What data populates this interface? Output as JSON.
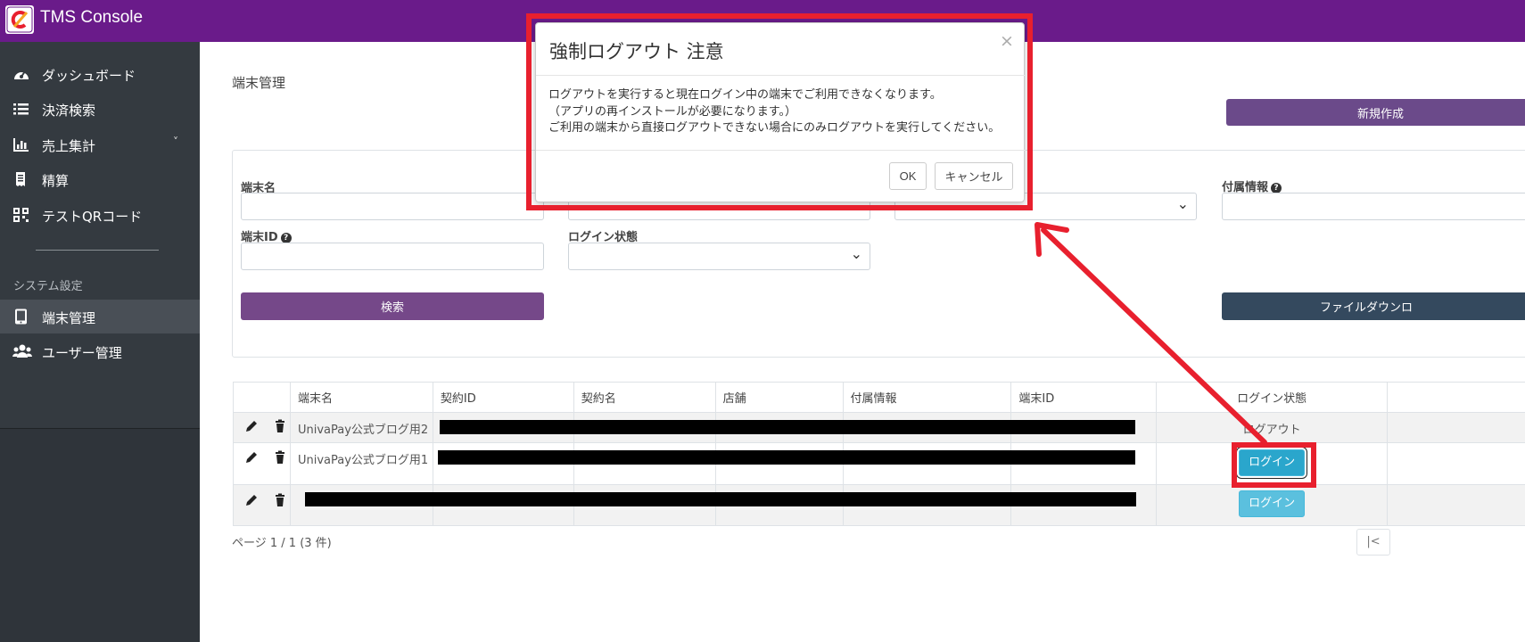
{
  "app": {
    "title": "TMS Console"
  },
  "sidebar": {
    "items": [
      {
        "label": "ダッシュボード",
        "icon": "dashboard-icon"
      },
      {
        "label": "決済検索",
        "icon": "list-icon"
      },
      {
        "label": "売上集計",
        "icon": "bar-chart-icon",
        "chevron": "˅"
      },
      {
        "label": "精算",
        "icon": "receipt-icon"
      },
      {
        "label": "テストQRコード",
        "icon": "qr-code-icon"
      }
    ],
    "section_heading": "システム設定",
    "settings_items": [
      {
        "label": "端末管理",
        "icon": "tablet-icon",
        "active": true
      },
      {
        "label": "ユーザー管理",
        "icon": "users-icon"
      }
    ]
  },
  "main": {
    "page_title": "端末管理",
    "new_button": "新規作成",
    "search": {
      "terminal_name_label": "端末名",
      "attachment_label": "付属情報",
      "terminal_id_label": "端末ID",
      "login_status_label": "ログイン状態",
      "search_button": "検索",
      "download_button": "ファイルダウンロ"
    },
    "table": {
      "headers": [
        "",
        "端末名",
        "契約ID",
        "契約名",
        "店舗",
        "付属情報",
        "端末ID",
        "ログイン状態",
        ""
      ],
      "rows": [
        {
          "name": "UnivaPay公式ブログ用2",
          "status_text": "ログアウト"
        },
        {
          "name": "UnivaPay公式ブログ用1",
          "status_button": "ログイン"
        },
        {
          "name": "",
          "status_button": "ログイン"
        }
      ]
    },
    "pager": {
      "info": "ページ 1 / 1 (3 件)",
      "first": "|<"
    }
  },
  "modal": {
    "title": "強制ログアウト 注意",
    "close": "×",
    "body_lines": [
      "ログアウトを実行すると現在ログイン中の端末でご利用できなくなります。",
      "（アプリの再インストールが必要になります。）",
      "ご利用の端末から直接ログアウトできない場合にのみログアウトを実行してください。"
    ],
    "ok_button": "OK",
    "cancel_button": "キャンセル"
  },
  "colors": {
    "topbar": "#6a1b8a",
    "sidebar": "#343a40",
    "primary_button": "#754889",
    "info_button": "#5bc0de",
    "annotation_red": "#e8202e"
  }
}
